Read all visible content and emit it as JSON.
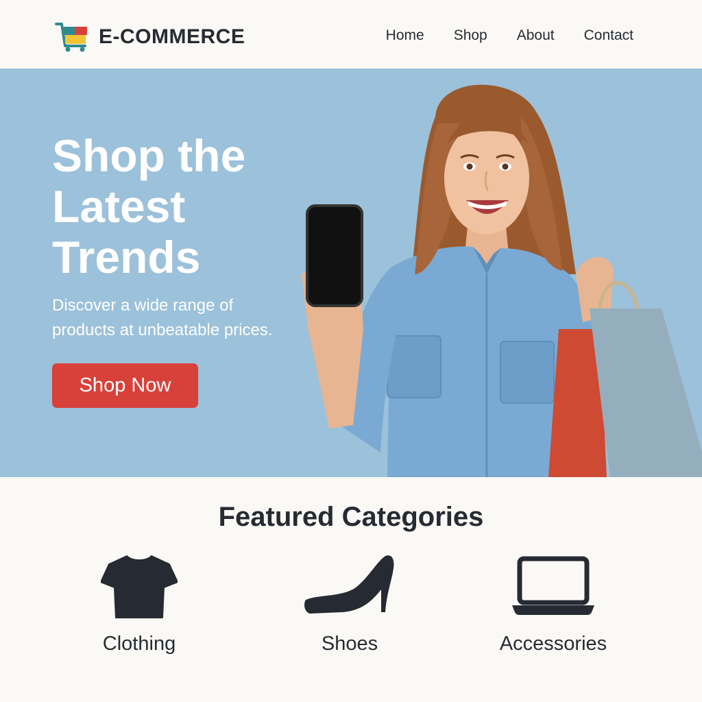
{
  "brand": {
    "name": "E-COMMERCE",
    "icon": "shopping-cart-icon"
  },
  "nav": {
    "items": [
      "Home",
      "Shop",
      "About",
      "Contact"
    ]
  },
  "hero": {
    "title_lines": [
      "Shop the",
      "Latest",
      "Trends"
    ],
    "subtitle_lines": [
      "Discover a wide range of",
      "products at unbeatable prices."
    ],
    "cta_label": "Shop Now",
    "background_color": "#9cc1da",
    "cta_color": "#d8413a"
  },
  "featured": {
    "title": "Featured Categories",
    "categories": [
      {
        "label": "Clothing",
        "icon": "tshirt-icon"
      },
      {
        "label": "Shoes",
        "icon": "high-heel-icon"
      },
      {
        "label": "Accessories",
        "icon": "laptop-icon"
      }
    ]
  },
  "colors": {
    "text": "#262b33",
    "page_background": "#fbf9f5"
  }
}
